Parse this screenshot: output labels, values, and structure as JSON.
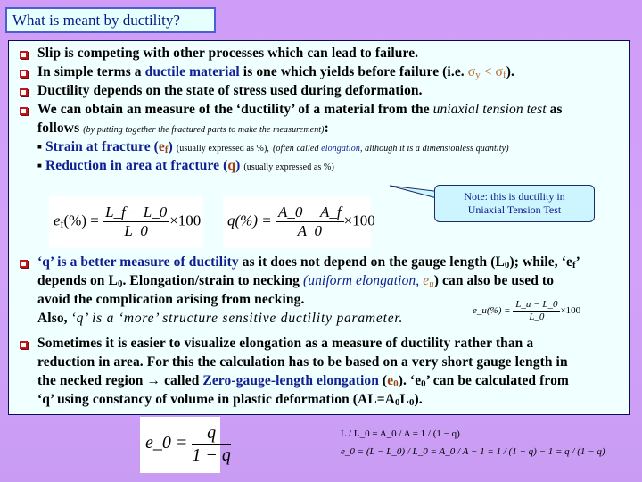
{
  "title": "What is meant by ductility?",
  "bullets": {
    "b1": "Slip is competing with other processes which can lead to failure.",
    "b2_pre": "In simple terms a ",
    "b2_term": "ductile material",
    "b2_post": " is one which yields before failure (i.e. ",
    "b2_sy": "σ",
    "b2_sy_sub": "y",
    "b2_lt": " < ",
    "b2_sf": "σ",
    "b2_sf_sub": "f",
    "b2_end": ").",
    "b3": "Ductility depends on the state of stress used during deformation.",
    "b4_line1_pre": "We can obtain an measure of the ‘ductility’ of a material from the ",
    "b4_line1_ital": "uniaxial tension test",
    "b4_line1_post": " as",
    "b4_line2": "follows",
    "b4_line2_note": "(by putting together the fractured parts to make the measurement)",
    "b4_line2_end": ":"
  },
  "subbullets": {
    "s1_label": "Strain at fracture (",
    "s1_sym": "e",
    "s1_sym_sub": "f",
    "s1_close": ")",
    "s1_note": "(usually expressed as %),",
    "s1_ital_pre": "(often called ",
    "s1_ital_term": "elongation",
    "s1_ital_post": ", although it is a dimensionless quantity)",
    "s2_label": "Reduction in area at fracture (",
    "s2_sym": "q",
    "s2_close": ")",
    "s2_note": "(usually expressed as %)"
  },
  "formulas": {
    "ef_lhs": "e",
    "ef_lhs_sub": "f",
    "ef_pct": "(%) =",
    "ef_num": "L_f − L_0",
    "ef_den": "L_0",
    "ef_mult": "×100",
    "q_lhs": "q(%) =",
    "q_num": "A_0 − A_f",
    "q_den": "A_0",
    "q_mult": "×100",
    "eu_lhs": "e_u(%) =",
    "eu_num": "L_u − L_0",
    "eu_den": "L_0",
    "eu_mult": "×100",
    "e0_lhs": "e_0 =",
    "e0_num": "q",
    "e0_den": "1 − q",
    "chain1": [
      "L / L_0",
      "=",
      "A_0 / A",
      "=",
      "1 / (1 − q)"
    ],
    "chain2": [
      "e_0 =",
      "(L − L_0) / L_0",
      "=",
      "A_0 / A",
      "− 1 =",
      "1 / (1 − q)",
      "− 1 =",
      "q / (1 − q)"
    ]
  },
  "note": {
    "line1": "Note: this is ductility in",
    "line2": "Uniaxial Tension Test"
  },
  "lower": {
    "b5_term": "‘q’ is a better measure of ductility",
    "b5_post": " as it does not depend on the gauge length (L",
    "b5_sub": "0",
    "b5_end": "); while, ‘e",
    "b5_ef_sub": "f",
    "b5_q": "’",
    "b5_l2_pre": "depends on L",
    "b5_l2_sub": "0",
    "b5_l2_mid": ". Elongation/strain to necking ",
    "b5_l2_ital": "(uniform elongation, ",
    "b5_l2_eu": "e",
    "b5_l2_eu_sub": "u",
    "b5_l2_close": ")",
    "b5_l2_post": " can also be used to",
    "b5_l3": "avoid the complication arising from necking.",
    "b5_l4_pre": "Also, ",
    "b5_l4_ital": "‘q’ is a ‘more’ structure sensitive ductility parameter.",
    "b6_l1": "Sometimes it is easier to visualize elongation as a measure of ductility rather than a",
    "b6_l2": "reduction in area. For this the calculation has to be based on a very short gauge length in",
    "b6_l3_pre": "the necked region → called ",
    "b6_l3_term": "Zero-gauge-length elongation",
    "b6_l3_open": " (",
    "b6_l3_sym": "e",
    "b6_l3_sym_sub": "0",
    "b6_l3_post": "). ‘e",
    "b6_l3_sub2": "0",
    "b6_l3_end": "’ can be calculated from",
    "b6_l4_pre": "‘q’ using constancy of volume in plastic deformation (AL=A",
    "b6_l4_sub1": "0",
    "b6_l4_mid": "L",
    "b6_l4_sub2": "0",
    "b6_l4_end": ")."
  },
  "colors": {
    "background": "#cf9cf7",
    "panel": "#f0ffff",
    "title_box": "#e6ffff",
    "term_blue": "#102090",
    "symbol_brown": "#9c3e12",
    "bullet_red": "#c0161a"
  }
}
